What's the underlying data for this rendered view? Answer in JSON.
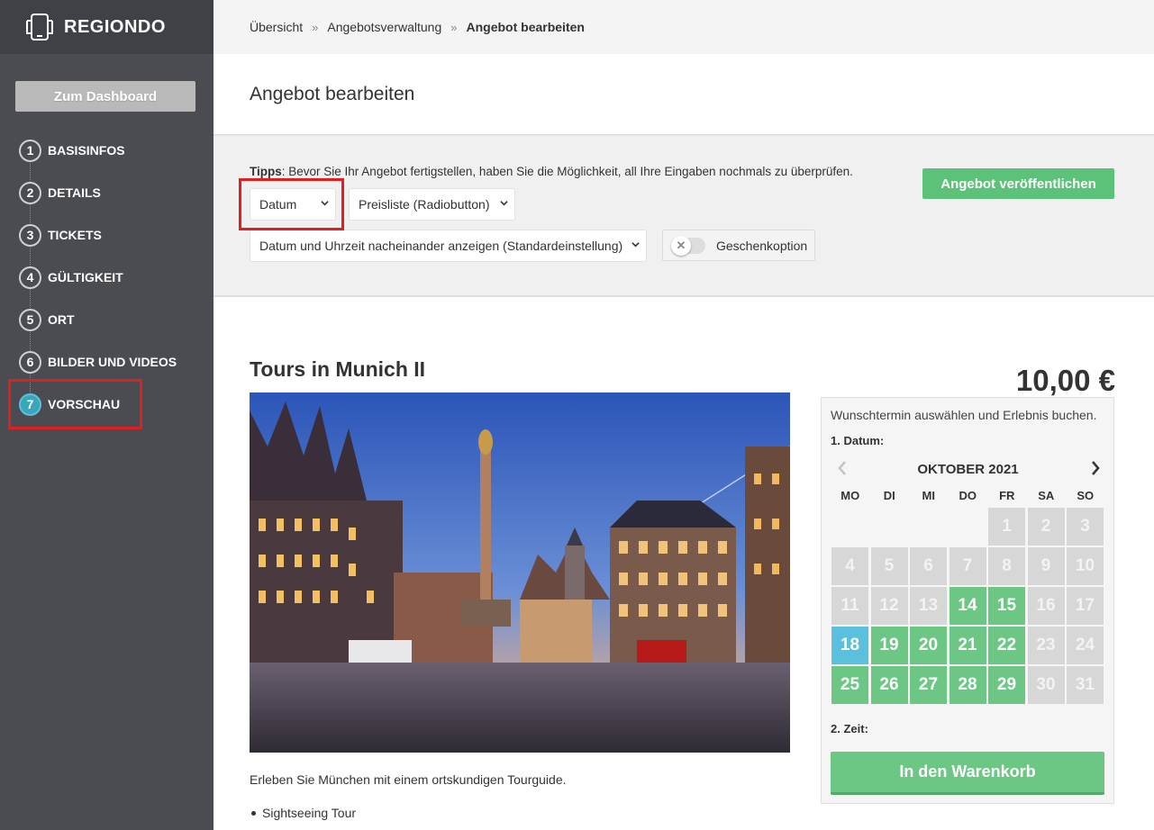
{
  "brand": {
    "name": "REGIONDO"
  },
  "sidebar": {
    "dashboard_label": "Zum Dashboard",
    "steps": [
      {
        "num": "1",
        "label": "BASISINFOS"
      },
      {
        "num": "2",
        "label": "DETAILS"
      },
      {
        "num": "3",
        "label": "TICKETS"
      },
      {
        "num": "4",
        "label": "GÜLTIGKEIT"
      },
      {
        "num": "5",
        "label": "ORT"
      },
      {
        "num": "6",
        "label": "BILDER UND VIDEOS"
      },
      {
        "num": "7",
        "label": "VORSCHAU"
      }
    ],
    "active_step": "7"
  },
  "breadcrumb": {
    "items": [
      "Übersicht",
      "Angebotsverwaltung",
      "Angebot bearbeiten"
    ],
    "separator": "»"
  },
  "page": {
    "title": "Angebot bearbeiten"
  },
  "tips": {
    "label": "Tipps",
    "text": ": Bevor Sie Ihr Angebot fertigstellen, haben Sie die Möglichkeit, all Ihre Eingaben nochmals zu überprüfen.",
    "publish_label": "Angebot veröffentlichen",
    "select_datum": "Datum",
    "select_preisliste": "Preisliste (Radiobutton)",
    "select_anzeige": "Datum und Uhrzeit nacheinander anzeigen (Standardeinstellung)",
    "gift_label": "Geschenkoption",
    "gift_enabled": false
  },
  "product": {
    "title": "Tours in Munich II",
    "description": "Erleben Sie München mit einem ortskundigen Tourguide.",
    "bullets": [
      "Sightseeing Tour"
    ],
    "price": "10,00 €"
  },
  "booking": {
    "intro": "Wunschtermin auswählen und Erlebnis buchen.",
    "date_label": "1. Datum:",
    "month": "OKTOBER 2021",
    "weekdays": [
      "MO",
      "DI",
      "MI",
      "DO",
      "FR",
      "SA",
      "SO"
    ],
    "first_weekday_index": 4,
    "days_in_month": 31,
    "available_days": [
      14,
      15,
      19,
      20,
      21,
      22,
      25,
      26,
      27,
      28,
      29
    ],
    "selected_day": 18,
    "time_label": "2. Zeit:",
    "cart_label": "In den Warenkorb"
  },
  "colors": {
    "sidebar_bg": "#4a4c52",
    "accent_green": "#6cc785",
    "selected_blue": "#5bc0de",
    "highlight_red": "#e02020"
  }
}
